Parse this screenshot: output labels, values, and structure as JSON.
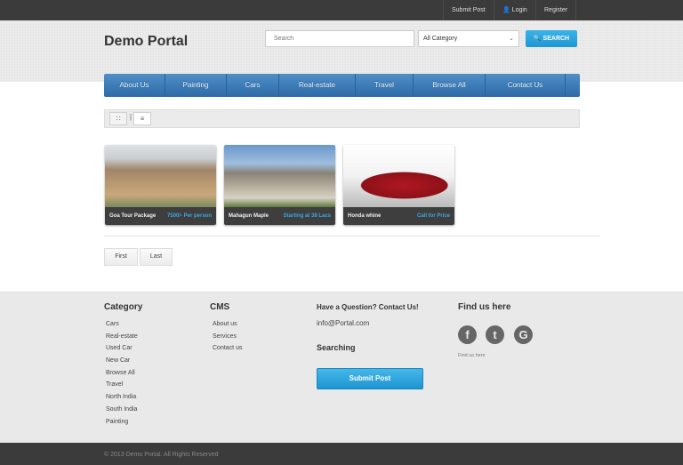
{
  "topbar": {
    "submit_post": "Submit Post",
    "login": "Login",
    "register": "Register"
  },
  "header": {
    "title": "Demo Portal",
    "search_placeholder": "Search",
    "category_selected": "All Category",
    "search_button": "SEARCH"
  },
  "nav": [
    "About Us",
    "Painting",
    "Cars",
    "Real-estate",
    "Travel",
    "Browse All",
    "Contact Us"
  ],
  "listings": [
    {
      "name": "Goa Tour Package",
      "price": "7500/- Per person"
    },
    {
      "name": "Mahagun Maple",
      "price": "Starting at 38 Lacs"
    },
    {
      "name": "Honda whine",
      "price": "Call for Price"
    }
  ],
  "pagination": {
    "first": "First",
    "last": "Last"
  },
  "footer": {
    "category_title": "Category",
    "categories": [
      "Cars",
      "Real-estate",
      "Used Car",
      "New Car",
      "Browse All",
      "Travel",
      "North India",
      "South India",
      "Painting"
    ],
    "cms_title": "CMS",
    "cms": [
      "About us",
      "Services",
      "Contact us"
    ],
    "contact_title": "Have a Question? Contact Us!",
    "email": "info@Portal.com",
    "searching_title": "Searching",
    "submit_post": "Submit Post",
    "find_title": "Find us here",
    "find_text": "Find us here",
    "copyright": "© 2013 Demo Portal. All Rights Reserved"
  },
  "colors": {
    "accent": "#2aa3dc",
    "nav": "#3b78b5",
    "dark": "#3b3b3b"
  }
}
